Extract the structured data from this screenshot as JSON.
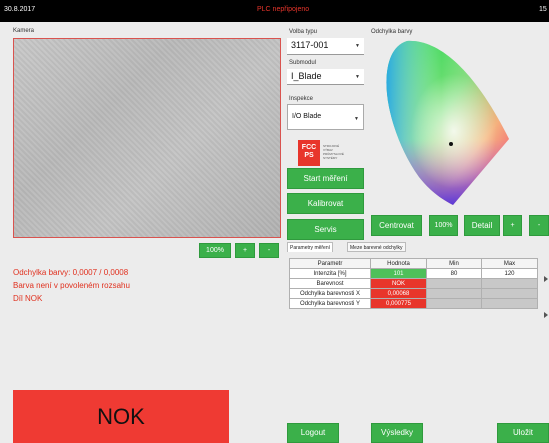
{
  "topbar": {
    "date": "30.8.2017",
    "status": "PLC nepřipojeno",
    "clock": "15"
  },
  "camera": {
    "label": "Kamera",
    "zoom": "100%",
    "plus": "+",
    "minus": "-"
  },
  "messages": [
    "Odchylka barvy: 0,0007 / 0,0008",
    "Barva není v povoleném rozsahu",
    "Díl NOK"
  ],
  "result": "NOK",
  "type_select": {
    "label": "Volba typu",
    "value": "3117-001"
  },
  "submodule": {
    "label": "Submodul",
    "value": "I_Blade"
  },
  "inspection": {
    "label": "Inspekce",
    "value": "I/O Blade"
  },
  "logo": {
    "mark": "FCC PS",
    "text": "STROJOVÉ\nVÝBAV\nPRŮMYSLOVÉ\nSYSTÉMY"
  },
  "buttons": {
    "start": "Start měření",
    "calibrate": "Kalibrovat",
    "service": "Servis",
    "logout": "Logout",
    "results": "Výsledky",
    "save": "Uložit"
  },
  "color_panel": {
    "label": "Odchylka barvy",
    "center": "Centrovat",
    "zoom": "100%",
    "detail": "Detail",
    "plus": "+",
    "minus": "-"
  },
  "tabs": [
    "Parametry měření",
    "Meze barevné odchylky"
  ],
  "table": {
    "headers": [
      "Parametr",
      "Hodnota",
      "Min",
      "Max"
    ],
    "rows": [
      {
        "name": "Intenzita [%]",
        "value": "101",
        "min": "80",
        "max": "120",
        "state": "green"
      },
      {
        "name": "Barevnost",
        "value": "NOK",
        "min": "",
        "max": "",
        "state": "red"
      },
      {
        "name": "Odchylka barevnosti X",
        "value": "0,00068",
        "min": "",
        "max": "",
        "state": "red"
      },
      {
        "name": "Odchylka barevnosti Y",
        "value": "0,000775",
        "min": "",
        "max": "",
        "state": "red"
      }
    ]
  }
}
